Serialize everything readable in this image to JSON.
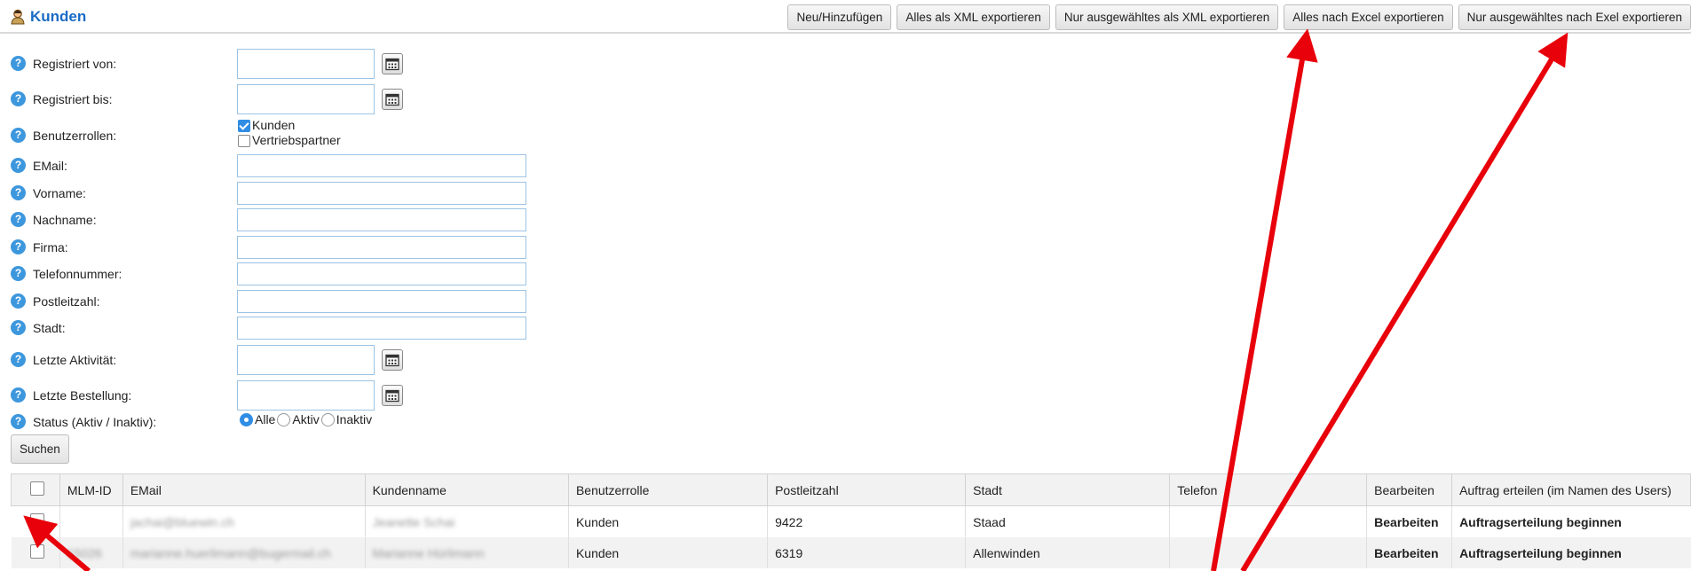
{
  "header": {
    "title": "Kunden",
    "buttons": [
      "Neu/Hinzufügen",
      "Alles als XML exportieren",
      "Nur ausgewähltes als XML exportieren",
      "Alles nach Excel exportieren",
      "Nur ausgewähltes nach Exel exportieren"
    ]
  },
  "filters": {
    "registered_from": "Registriert von:",
    "registered_to": "Registriert bis:",
    "roles": "Benutzerrollen:",
    "role_options": [
      "Kunden",
      "Vertriebspartner"
    ],
    "role_checked": [
      "Kunden"
    ],
    "email": "EMail:",
    "firstname": "Vorname:",
    "lastname": "Nachname:",
    "company": "Firma:",
    "phone": "Telefonnummer:",
    "zip": "Postleitzahl:",
    "city": "Stadt:",
    "last_activity": "Letzte Aktivität:",
    "last_order": "Letzte Bestellung:",
    "status": "Status (Aktiv / Inaktiv):",
    "status_options": [
      "Alle",
      "Aktiv",
      "Inaktiv"
    ],
    "status_selected": "Alle",
    "search_button": "Suchen"
  },
  "table": {
    "columns": [
      "MLM-ID",
      "EMail",
      "Kundenname",
      "Benutzerrolle",
      "Postleitzahl",
      "Stadt",
      "Telefon",
      "Bearbeiten",
      "Auftrag erteilen (im Namen des Users)"
    ],
    "rows": [
      {
        "mlm_id": "",
        "email": "jachai@bluewin.ch",
        "name": "Jeanette Schai",
        "role": "Kunden",
        "zip": "9422",
        "city": "Staad",
        "phone": "",
        "edit": "Bearbeiten",
        "order": "Auftragserteilung beginnen"
      },
      {
        "mlm_id": "15026",
        "email": "marianne.huerlimann@bugermail.ch",
        "name": "Marianne Hürlimann",
        "role": "Kunden",
        "zip": "6319",
        "city": "Allenwinden",
        "phone": "",
        "edit": "Bearbeiten",
        "order": "Auftragserteilung beginnen"
      }
    ]
  },
  "colors": {
    "accent": "#1a6bc4",
    "link": "#1a7bd6",
    "arrow": "#e8000b",
    "help_icon": "#3d97dd"
  }
}
